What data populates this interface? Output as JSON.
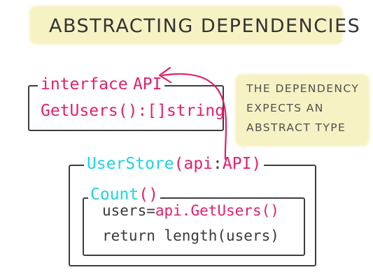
{
  "title": "ABSTRACTING DEPENDENCIES",
  "note": {
    "line1": "THE DEPENDENCY",
    "line2": "EXPECTS AN",
    "line3": "ABSTRACT TYPE"
  },
  "interface_box": {
    "keyword": "interface",
    "name": "API",
    "method": "GetUsers():[]string"
  },
  "struct_box": {
    "name": "UserStore",
    "paren_open": "(",
    "param": "api",
    "colon": ":",
    "param_type": "API",
    "paren_close": ")"
  },
  "method_box": {
    "name": "Count",
    "parens": "()",
    "line1_var": "users",
    "line1_eq": "=",
    "line1_call": "api.GetUsers()",
    "line2": "return length(users)"
  },
  "colors": {
    "keyword": "#e0206c",
    "identifier": "#1fd3e3",
    "text": "#3a3a3a",
    "highlight": "#f7f2c4"
  }
}
